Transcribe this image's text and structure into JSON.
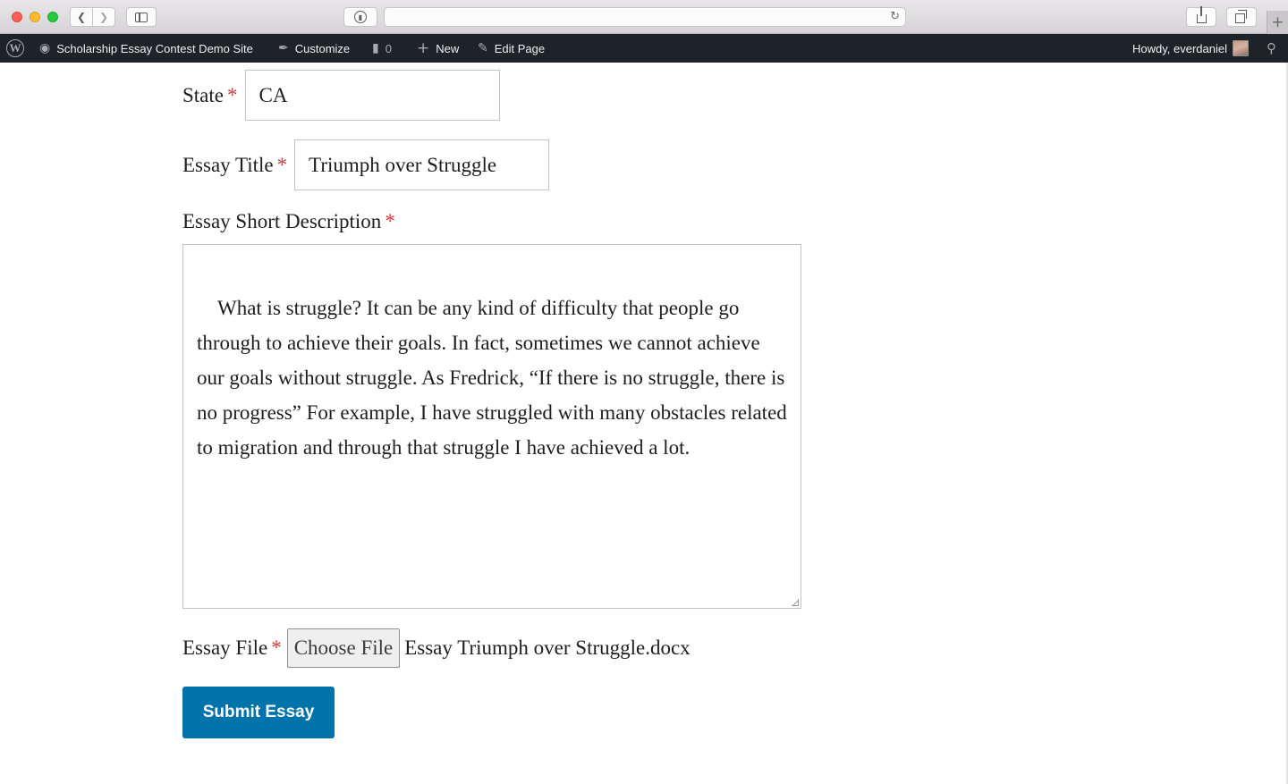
{
  "browser": {
    "back_icon": "chevron-left-icon",
    "forward_icon": "chevron-right-icon",
    "sidebar_icon": "sidebar-icon",
    "privacy_icon": "privacy-report-icon",
    "address": "",
    "reload_icon": "reload-icon",
    "share_icon": "share-icon",
    "tabs_icon": "tab-overview-icon",
    "new_tab_label": "+"
  },
  "admin_bar": {
    "site_name": "Scholarship Essay Contest Demo Site",
    "customize": "Customize",
    "comments_count": "0",
    "new": "New",
    "edit_page": "Edit Page",
    "howdy": "Howdy, everdaniel"
  },
  "form": {
    "state": {
      "label": "State",
      "required": "*",
      "value": "CA"
    },
    "essay_title": {
      "label": "Essay Title",
      "required": "*",
      "value": "Triumph over Struggle"
    },
    "essay_description": {
      "label": "Essay Short Description",
      "required": "*",
      "value": "What is struggle? It can be any kind of difficulty that people go through to achieve their goals. In fact, sometimes we cannot achieve our goals without struggle. As Fredrick, “If there is no struggle, there is no progress” For example, I have struggled with many obstacles related to migration and through that struggle I have achieved a lot."
    },
    "essay_file": {
      "label": "Essay File",
      "required": "*",
      "button": "Choose File",
      "file_name": "Essay Triumph over Struggle.docx"
    },
    "submit": "Submit Essay"
  },
  "colors": {
    "admin_bar_bg": "#1d2327",
    "required": "#d63638",
    "submit_bg": "#0073aa"
  }
}
